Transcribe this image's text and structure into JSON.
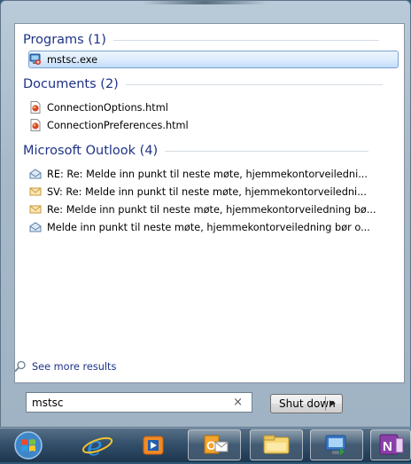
{
  "groups": [
    {
      "title": "Programs (1)",
      "items": [
        {
          "label": "mstsc.exe",
          "icon": "remote-desktop-icon",
          "selected": true
        }
      ]
    },
    {
      "title": "Documents (2)",
      "items": [
        {
          "label": "ConnectionOptions.html",
          "icon": "html-file-icon"
        },
        {
          "label": "ConnectionPreferences.html",
          "icon": "html-file-icon"
        }
      ]
    },
    {
      "title": "Microsoft Outlook (4)",
      "items": [
        {
          "label": "RE: Re: Melde inn punkt til neste møte, hjemmekontorveiledni...",
          "icon": "mail-open-icon"
        },
        {
          "label": "SV: Re: Melde inn punkt til neste møte, hjemmekontorveiledni...",
          "icon": "mail-closed-icon"
        },
        {
          "label": "Re: Melde inn punkt til neste møte, hjemmekontorveiledning bø...",
          "icon": "mail-closed-icon"
        },
        {
          "label": "Melde inn punkt til neste møte, hjemmekontorveiledning bør o...",
          "icon": "mail-open-icon"
        }
      ]
    }
  ],
  "see_more": "See more results",
  "search": {
    "value": "mstsc",
    "clear_glyph": "×"
  },
  "shutdown": {
    "label": "Shut down",
    "arrow": "▶"
  },
  "taskbar": [
    "start-orb-icon",
    "internet-explorer-icon",
    "media-player-icon",
    "outlook-icon",
    "file-explorer-icon",
    "remote-desktop-icon",
    "onenote-icon"
  ],
  "colors": {
    "group_header": "#1e3287",
    "selection": "#c1dcfc",
    "taskbar": "#2f4b66"
  }
}
